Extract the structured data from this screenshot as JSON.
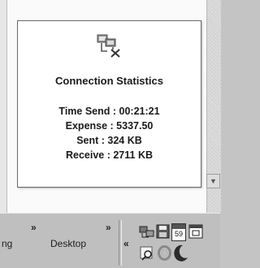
{
  "popup": {
    "title": "Connection Statistics",
    "stats": [
      "Time Send : 00:21:21",
      "Expense : 5337.50",
      "Sent : 324 KB",
      "Receive : 2711 KB"
    ]
  },
  "taskbar": {
    "truncated_item": "ng",
    "desktop_label": "Desktop",
    "overflow_chevron": "»",
    "collapse_chevron": "«",
    "tray_badge": "59"
  },
  "icons": {
    "popup_icon": "network-disconnected-icon",
    "tray": [
      "network-icon",
      "save-disk-icon",
      "calendar-icon",
      "window-icon",
      "magnifier-icon",
      "ring-icon",
      "moon-icon"
    ]
  }
}
